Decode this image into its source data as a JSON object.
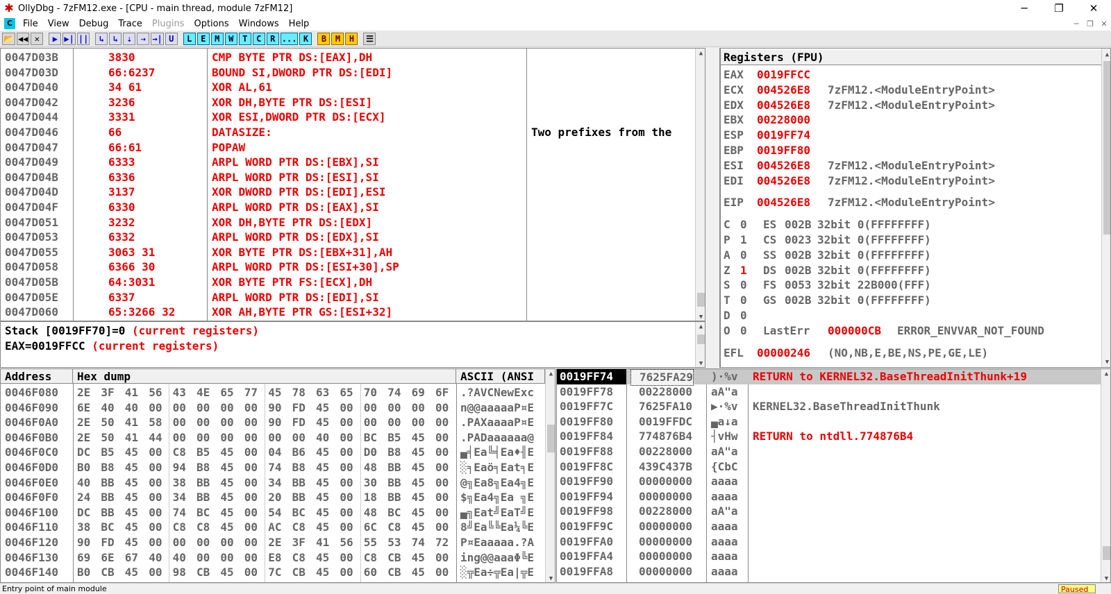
{
  "window": {
    "title": "OllyDbg - 7zFM12.exe - [CPU - main thread, module 7zFM12]",
    "minimize_glyph": "─",
    "restore_glyph": "❐",
    "close_glyph": "✕"
  },
  "menu": {
    "icon_label": "C",
    "items": [
      "File",
      "View",
      "Debug",
      "Trace",
      "Plugins",
      "Options",
      "Windows",
      "Help"
    ]
  },
  "toolbar": {
    "buttons": [
      "📂",
      "◀◀",
      "✕",
      "▶",
      "▶|",
      "||",
      "↳",
      "↳",
      "⇣",
      "⇢",
      "→|",
      "U",
      "L",
      "E",
      "M",
      "W",
      "T",
      "C",
      "R",
      "...",
      "K",
      "B",
      "M",
      "H",
      "☰"
    ]
  },
  "disasm": {
    "rows": [
      {
        "addr": "0047D03B",
        "hex": "3830",
        "instr": "CMP BYTE PTR DS:[EAX],DH",
        "comment": ""
      },
      {
        "addr": "0047D03D",
        "hex": "66:6237",
        "instr": "BOUND SI,DWORD PTR DS:[EDI]",
        "comment": ""
      },
      {
        "addr": "0047D040",
        "hex": "34 61",
        "instr": "XOR AL,61",
        "comment": ""
      },
      {
        "addr": "0047D042",
        "hex": "3236",
        "instr": "XOR DH,BYTE PTR DS:[ESI]",
        "comment": ""
      },
      {
        "addr": "0047D044",
        "hex": "3331",
        "instr": "XOR ESI,DWORD PTR DS:[ECX]",
        "comment": ""
      },
      {
        "addr": "0047D046",
        "hex": "66",
        "instr": "DATASIZE:",
        "comment": "Two prefixes from the"
      },
      {
        "addr": "0047D047",
        "hex": "66:61",
        "instr": "POPAW",
        "comment": ""
      },
      {
        "addr": "0047D049",
        "hex": "6333",
        "instr": "ARPL WORD PTR DS:[EBX],SI",
        "comment": ""
      },
      {
        "addr": "0047D04B",
        "hex": "6336",
        "instr": "ARPL WORD PTR DS:[ESI],SI",
        "comment": ""
      },
      {
        "addr": "0047D04D",
        "hex": "3137",
        "instr": "XOR DWORD PTR DS:[EDI],ESI",
        "comment": ""
      },
      {
        "addr": "0047D04F",
        "hex": "6330",
        "instr": "ARPL WORD PTR DS:[EAX],SI",
        "comment": ""
      },
      {
        "addr": "0047D051",
        "hex": "3232",
        "instr": "XOR DH,BYTE PTR DS:[EDX]",
        "comment": ""
      },
      {
        "addr": "0047D053",
        "hex": "6332",
        "instr": "ARPL WORD PTR DS:[EDX],SI",
        "comment": ""
      },
      {
        "addr": "0047D055",
        "hex": "3063 31",
        "instr": "XOR BYTE PTR DS:[EBX+31],AH",
        "comment": ""
      },
      {
        "addr": "0047D058",
        "hex": "6366 30",
        "instr": "ARPL WORD PTR DS:[ESI+30],SP",
        "comment": ""
      },
      {
        "addr": "0047D05B",
        "hex": "64:3031",
        "instr": "XOR BYTE PTR FS:[ECX],DH",
        "comment": ""
      },
      {
        "addr": "0047D05E",
        "hex": "6337",
        "instr": "ARPL WORD PTR DS:[EDI],SI",
        "comment": ""
      },
      {
        "addr": "0047D060",
        "hex": "65:3266 32",
        "instr": "XOR AH,BYTE PTR GS:[ESI+32]",
        "comment": ""
      }
    ]
  },
  "info": {
    "line1_prefix": "Stack [0019FF70]=0 ",
    "line1_suffix": "(current registers)",
    "line2_prefix": "EAX=0019FFCC ",
    "line2_suffix": "(current registers)"
  },
  "registers": {
    "title": "Registers (FPU)",
    "gp": [
      {
        "name": "EAX",
        "value": "0019FFCC",
        "comment": ""
      },
      {
        "name": "ECX",
        "value": "004526E8",
        "comment": "7zFM12.<ModuleEntryPoint>"
      },
      {
        "name": "EDX",
        "value": "004526E8",
        "comment": "7zFM12.<ModuleEntryPoint>"
      },
      {
        "name": "EBX",
        "value": "00228000",
        "comment": ""
      },
      {
        "name": "ESP",
        "value": "0019FF74",
        "comment": ""
      },
      {
        "name": "EBP",
        "value": "0019FF80",
        "comment": ""
      },
      {
        "name": "ESI",
        "value": "004526E8",
        "comment": "7zFM12.<ModuleEntryPoint>"
      },
      {
        "name": "EDI",
        "value": "004526E8",
        "comment": "7zFM12.<ModuleEntryPoint>"
      }
    ],
    "eip": {
      "name": "EIP",
      "value": "004526E8",
      "comment": "7zFM12.<ModuleEntryPoint>"
    },
    "flags": [
      {
        "flag": "C",
        "val": "0",
        "seg": "ES",
        "sel": "002B",
        "desc": "32bit 0(FFFFFFFF)",
        "changed": false
      },
      {
        "flag": "P",
        "val": "1",
        "seg": "CS",
        "sel": "0023",
        "desc": "32bit 0(FFFFFFFF)",
        "changed": false
      },
      {
        "flag": "A",
        "val": "0",
        "seg": "SS",
        "sel": "002B",
        "desc": "32bit 0(FFFFFFFF)",
        "changed": false
      },
      {
        "flag": "Z",
        "val": "1",
        "seg": "DS",
        "sel": "002B",
        "desc": "32bit 0(FFFFFFFF)",
        "changed": true
      },
      {
        "flag": "S",
        "val": "0",
        "seg": "FS",
        "sel": "0053",
        "desc": "32bit 22B000(FFF)",
        "changed": false
      },
      {
        "flag": "T",
        "val": "0",
        "seg": "GS",
        "sel": "002B",
        "desc": "32bit 0(FFFFFFFF)",
        "changed": false
      },
      {
        "flag": "D",
        "val": "0",
        "seg": "",
        "sel": "",
        "desc": "",
        "changed": false
      }
    ],
    "lasterr": {
      "flag": "O",
      "val": "0",
      "label": "LastErr",
      "value": "000000CB",
      "desc": "ERROR_ENVVAR_NOT_FOUND"
    },
    "efl": {
      "label": "EFL",
      "value": "00000246",
      "desc": "(NO,NB,E,BE,NS,PE,GE,LE)"
    }
  },
  "dump": {
    "headers": {
      "address": "Address",
      "hex": "Hex dump",
      "ascii": "ASCII (ANSI"
    },
    "rows": [
      {
        "addr": "0046F080",
        "bytes": [
          "2E",
          "3F",
          "41",
          "56",
          "43",
          "4E",
          "65",
          "77",
          "45",
          "78",
          "63",
          "65",
          "70",
          "74",
          "69",
          "6F"
        ],
        "ascii": ".?AVCNewExc"
      },
      {
        "addr": "0046F090",
        "bytes": [
          "6E",
          "40",
          "40",
          "00",
          "00",
          "00",
          "00",
          "00",
          "90",
          "FD",
          "45",
          "00",
          "00",
          "00",
          "00",
          "00"
        ],
        "ascii": "n@@aaaaaP¤E"
      },
      {
        "addr": "0046F0A0",
        "bytes": [
          "2E",
          "50",
          "41",
          "58",
          "00",
          "00",
          "00",
          "00",
          "90",
          "FD",
          "45",
          "00",
          "00",
          "00",
          "00",
          "00"
        ],
        "ascii": ".PAXaaaaP¤E"
      },
      {
        "addr": "0046F0B0",
        "bytes": [
          "2E",
          "50",
          "41",
          "44",
          "00",
          "00",
          "00",
          "00",
          "00",
          "00",
          "40",
          "00",
          "BC",
          "B5",
          "45",
          "00"
        ],
        "ascii": ".PADaaaaaa@"
      },
      {
        "addr": "0046F0C0",
        "bytes": [
          "DC",
          "B5",
          "45",
          "00",
          "C8",
          "B5",
          "45",
          "00",
          "04",
          "B6",
          "45",
          "00",
          "D0",
          "B8",
          "45",
          "00"
        ],
        "ascii": "▄╡Ea╚╡Ea♦╢E"
      },
      {
        "addr": "0046F0D0",
        "bytes": [
          "B0",
          "B8",
          "45",
          "00",
          "94",
          "B8",
          "45",
          "00",
          "74",
          "B8",
          "45",
          "00",
          "48",
          "BB",
          "45",
          "00"
        ],
        "ascii": "░╕Eaö╕Eat╕E"
      },
      {
        "addr": "0046F0E0",
        "bytes": [
          "40",
          "BB",
          "45",
          "00",
          "38",
          "BB",
          "45",
          "00",
          "34",
          "BB",
          "45",
          "00",
          "30",
          "BB",
          "45",
          "00"
        ],
        "ascii": "@╗Ea8╗Ea4╗E"
      },
      {
        "addr": "0046F0F0",
        "bytes": [
          "24",
          "BB",
          "45",
          "00",
          "34",
          "BB",
          "45",
          "00",
          "20",
          "BB",
          "45",
          "00",
          "18",
          "BB",
          "45",
          "00"
        ],
        "ascii": "$╗Ea4╗Ea ╗E"
      },
      {
        "addr": "0046F100",
        "bytes": [
          "DC",
          "BB",
          "45",
          "00",
          "74",
          "BC",
          "45",
          "00",
          "54",
          "BC",
          "45",
          "00",
          "48",
          "BC",
          "45",
          "00"
        ],
        "ascii": "▄╗Eat╝EaT╝E"
      },
      {
        "addr": "0046F110",
        "bytes": [
          "38",
          "BC",
          "45",
          "00",
          "C8",
          "C8",
          "45",
          "00",
          "AC",
          "C8",
          "45",
          "00",
          "6C",
          "C8",
          "45",
          "00"
        ],
        "ascii": "8╝Ea╚╚Ea¼╚E"
      },
      {
        "addr": "0046F120",
        "bytes": [
          "90",
          "FD",
          "45",
          "00",
          "00",
          "00",
          "00",
          "00",
          "2E",
          "3F",
          "41",
          "56",
          "55",
          "53",
          "74",
          "72"
        ],
        "ascii": "P¤Eaaaaa.?A"
      },
      {
        "addr": "0046F130",
        "bytes": [
          "69",
          "6E",
          "67",
          "40",
          "40",
          "00",
          "00",
          "00",
          "E8",
          "C8",
          "45",
          "00",
          "C8",
          "CB",
          "45",
          "00"
        ],
        "ascii": "ing@@aaaΦ╚E"
      },
      {
        "addr": "0046F140",
        "bytes": [
          "B0",
          "CB",
          "45",
          "00",
          "98",
          "CB",
          "45",
          "00",
          "7C",
          "CB",
          "45",
          "00",
          "60",
          "CB",
          "45",
          "00"
        ],
        "ascii": "░╦Ea÷╦Ea|╦E"
      }
    ]
  },
  "stack": {
    "rows": [
      {
        "addr": "0019FF74",
        "value": "7625FA29",
        "ascii": ")·%v",
        "comment": "RETURN to KERNEL32.BaseThreadInitThunk+19",
        "comment_red": true,
        "selected": true
      },
      {
        "addr": "0019FF78",
        "value": "00228000",
        "ascii": "aA\"a",
        "comment": "",
        "comment_red": false,
        "selected": false
      },
      {
        "addr": "0019FF7C",
        "value": "7625FA10",
        "ascii": "▶·%v",
        "comment": "KERNEL32.BaseThreadInitThunk",
        "comment_red": false,
        "selected": false
      },
      {
        "addr": "0019FF80",
        "value": "0019FFDC",
        "ascii": "▄a↓a",
        "comment": "",
        "comment_red": false,
        "selected": false
      },
      {
        "addr": "0019FF84",
        "value": "774876B4",
        "ascii": "┤vHw",
        "comment": "RETURN to ntdll.774876B4",
        "comment_red": true,
        "selected": false
      },
      {
        "addr": "0019FF88",
        "value": "00228000",
        "ascii": "aA\"a",
        "comment": "",
        "comment_red": false,
        "selected": false
      },
      {
        "addr": "0019FF8C",
        "value": "439C437B",
        "ascii": "{CbC",
        "comment": "",
        "comment_red": false,
        "selected": false
      },
      {
        "addr": "0019FF90",
        "value": "00000000",
        "ascii": "aaaa",
        "comment": "",
        "comment_red": false,
        "selected": false
      },
      {
        "addr": "0019FF94",
        "value": "00000000",
        "ascii": "aaaa",
        "comment": "",
        "comment_red": false,
        "selected": false
      },
      {
        "addr": "0019FF98",
        "value": "00228000",
        "ascii": "aA\"a",
        "comment": "",
        "comment_red": false,
        "selected": false
      },
      {
        "addr": "0019FF9C",
        "value": "00000000",
        "ascii": "aaaa",
        "comment": "",
        "comment_red": false,
        "selected": false
      },
      {
        "addr": "0019FFA0",
        "value": "00000000",
        "ascii": "aaaa",
        "comment": "",
        "comment_red": false,
        "selected": false
      },
      {
        "addr": "0019FFA4",
        "value": "00000000",
        "ascii": "aaaa",
        "comment": "",
        "comment_red": false,
        "selected": false
      },
      {
        "addr": "0019FFA8",
        "value": "00000000",
        "ascii": "aaaa",
        "comment": "",
        "comment_red": false,
        "selected": false
      }
    ]
  },
  "status": {
    "text": "Entry point of main module",
    "state": "Paused"
  },
  "colors": {
    "address": "#666666",
    "instruction": "#e00000",
    "accent_cyan": "#00c8e0"
  }
}
